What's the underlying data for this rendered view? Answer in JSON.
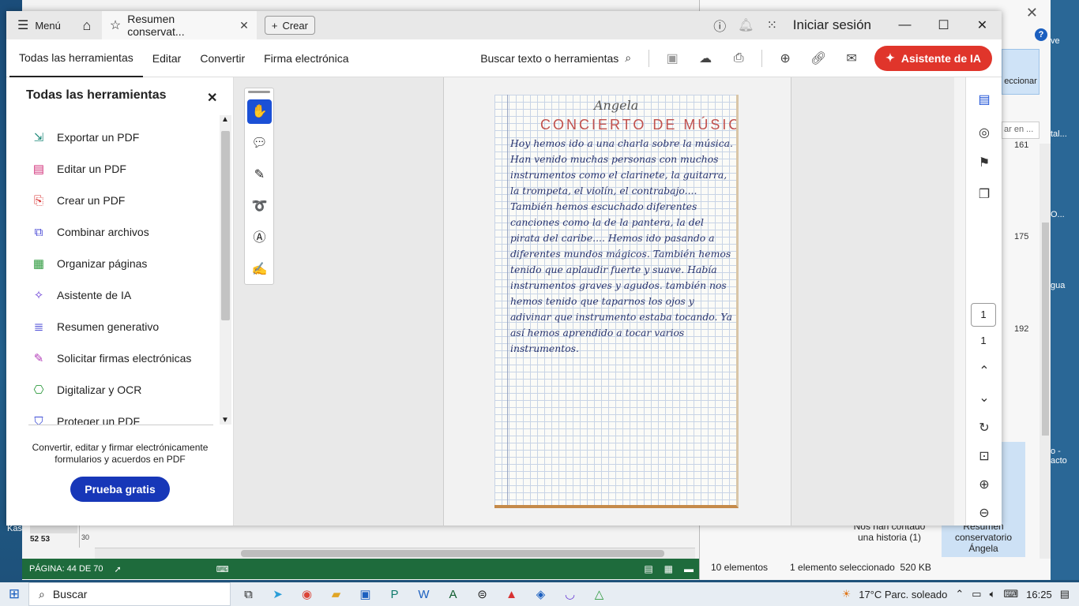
{
  "background": {
    "word_status_page": "PÁGINA: 44 DE 70",
    "word_thumb_numbers": "52 53",
    "word_ruler_num": "30",
    "explorer_ribbon_label": "eccionar",
    "explorer_search_placeholder": "ar en ...",
    "explorer_nums": [
      "161",
      "175",
      "192"
    ],
    "explorer_file1": "Nos han contado una historia (1)",
    "explorer_file2": "Resumen conservatorio Ángela",
    "explorer_count": "10 elementos",
    "explorer_selected": "1 elemento seleccionado",
    "explorer_size": "520 KB",
    "edge_texts": [
      "ve",
      "tal...",
      "O...",
      "gua",
      "o - acto",
      "Kas"
    ]
  },
  "titlebar": {
    "menu_label": "Menú",
    "tab_title": "Resumen conservat...",
    "create_label": "Crear",
    "signin_label": "Iniciar sesión"
  },
  "toolbar": {
    "tabs": [
      "Todas las herramientas",
      "Editar",
      "Convertir",
      "Firma electrónica"
    ],
    "search_label": "Buscar texto o herramientas",
    "ai_button": "Asistente de IA"
  },
  "panel": {
    "title": "Todas las herramientas",
    "tools": [
      {
        "label": "Exportar un PDF",
        "icon": "export-pdf-icon",
        "color": "#1f8a7a"
      },
      {
        "label": "Editar un PDF",
        "icon": "edit-pdf-icon",
        "color": "#d2307a"
      },
      {
        "label": "Crear un PDF",
        "icon": "create-pdf-icon",
        "color": "#d83232"
      },
      {
        "label": "Combinar archivos",
        "icon": "combine-files-icon",
        "color": "#4a4ad6"
      },
      {
        "label": "Organizar páginas",
        "icon": "organize-pages-icon",
        "color": "#2e9a3e"
      },
      {
        "label": "Asistente de IA",
        "icon": "ai-assistant-icon",
        "color": "#6a3ed6"
      },
      {
        "label": "Resumen generativo",
        "icon": "generative-summary-icon",
        "color": "#4a4ad6"
      },
      {
        "label": "Solicitar firmas electrónicas",
        "icon": "request-signatures-icon",
        "color": "#b23bb8"
      },
      {
        "label": "Digitalizar y OCR",
        "icon": "scan-ocr-icon",
        "color": "#2e9a3e"
      },
      {
        "label": "Proteger un PDF",
        "icon": "protect-pdf-icon",
        "color": "#3b4bd6"
      }
    ],
    "description": "Convertir, editar y firmar electrónicamente formularios y acuerdos en PDF",
    "trial_button": "Prueba gratis"
  },
  "document": {
    "name": "Angela",
    "heading": "CONCIERTO DE MÚSICA",
    "text": "Hoy hemos ido a una charla sobre la música. Han venido muchas personas con muchos instrumentos como el clarinete, la guitarra, la trompeta, el violín, el contrabajo.... También hemos escuchado diferentes canciones como la de la pantera, la del pirata del caribe.... Hemos ido pasando a diferentes mundos mágicos. También hemos tenido que aplaudir fuerte y suave. Había instrumentos graves y agudos. también nos hemos tenido que taparnos los ojos y adivinar que instrumento estaba tocando. Ya así hemos aprendido a tocar varios instrumentos."
  },
  "rail": {
    "page_current": "1",
    "page_total": "1"
  },
  "taskbar": {
    "search_label": "Buscar",
    "weather": "17°C  Parc. soleado",
    "time": "16:25"
  }
}
